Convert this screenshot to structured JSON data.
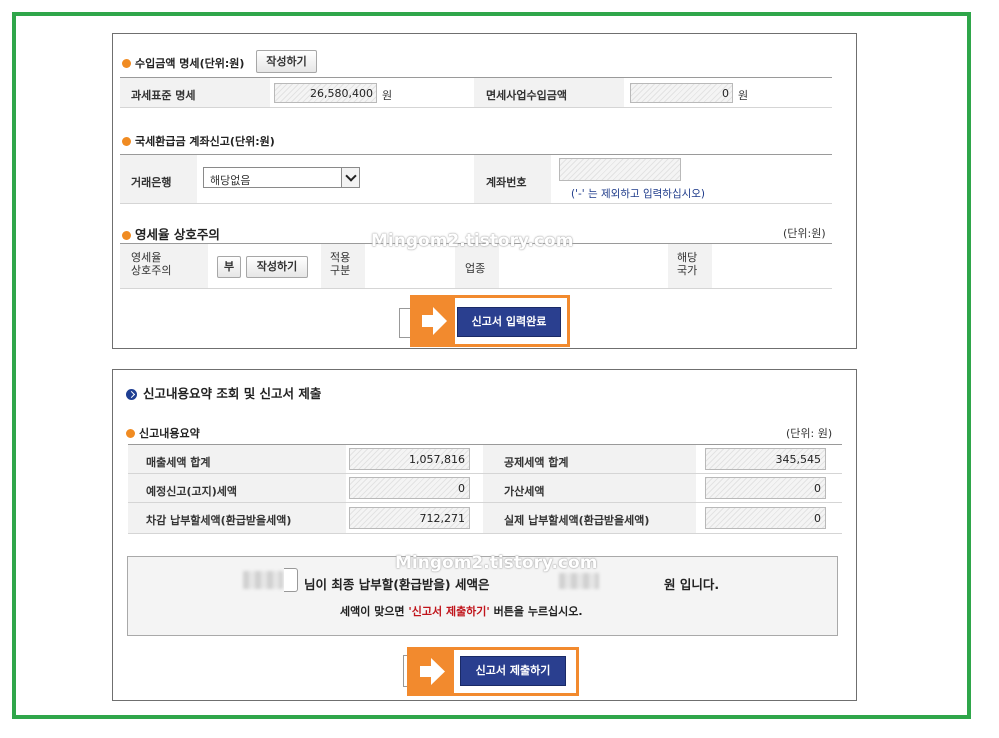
{
  "section_income": {
    "title": "수입금액 명세",
    "unit": "(단위:원)",
    "write_button": "작성하기",
    "tax_base_label": "과세표준 명세",
    "tax_base_value": "26,580,400",
    "tax_base_unit": "원",
    "exempt_label": "면세사업수입금액",
    "exempt_value": "0",
    "exempt_unit": "원"
  },
  "section_refund": {
    "title": "국세환급금 계좌신고",
    "unit": "(단위:원)",
    "bank_label": "거래은행",
    "bank_selected": "해당없음",
    "account_label": "계좌번호",
    "account_hint": "('-' 는 제외하고 입력하십시오)"
  },
  "section_zero": {
    "title": "영세율 상호주의",
    "unit": "(단위:원)",
    "label_line1": "영세율",
    "label_line2": "상호주의",
    "value_no": "부",
    "write_button": "작성하기",
    "apply_line1": "적용",
    "apply_line2": "구분",
    "industry_label": "업종",
    "country_line1": "해당",
    "country_line2": "국가"
  },
  "submit_input_button": "신고서 입력완료",
  "section_summary": {
    "title": "신고내용요약 조회 및 신고서 제출",
    "sub_title": "신고내용요약",
    "unit": "(단위: 원)",
    "rows": [
      {
        "label_left": "매출세액 합계",
        "value_left": "1,057,816",
        "label_right": "공제세액 합계",
        "value_right": "345,545"
      },
      {
        "label_left": "예정신고(고지)세액",
        "value_left": "0",
        "label_right": "가산세액",
        "value_right": "0"
      },
      {
        "label_left": "차감 납부할세액(환급받을세액)",
        "value_left": "712,271",
        "label_right": "실제 납부할세액(환급받을세액)",
        "value_right": "0"
      }
    ],
    "final_msg_mid": "님이 최종 납부할(환급받을) 세액은",
    "final_msg_end": "원 입니다.",
    "notice_pre": "세액이 맞으면 ",
    "notice_highlight": "'신고서 제출하기'",
    "notice_post": " 버튼을 누르십시오."
  },
  "submit_final_button": "신고서 제출하기",
  "watermark": "Mingom2.tistory.com",
  "colors": {
    "frame_green": "#2fa64a",
    "accent_orange": "#f28a2e",
    "button_blue": "#2a3f8f",
    "highlight_red": "#c0141b"
  }
}
